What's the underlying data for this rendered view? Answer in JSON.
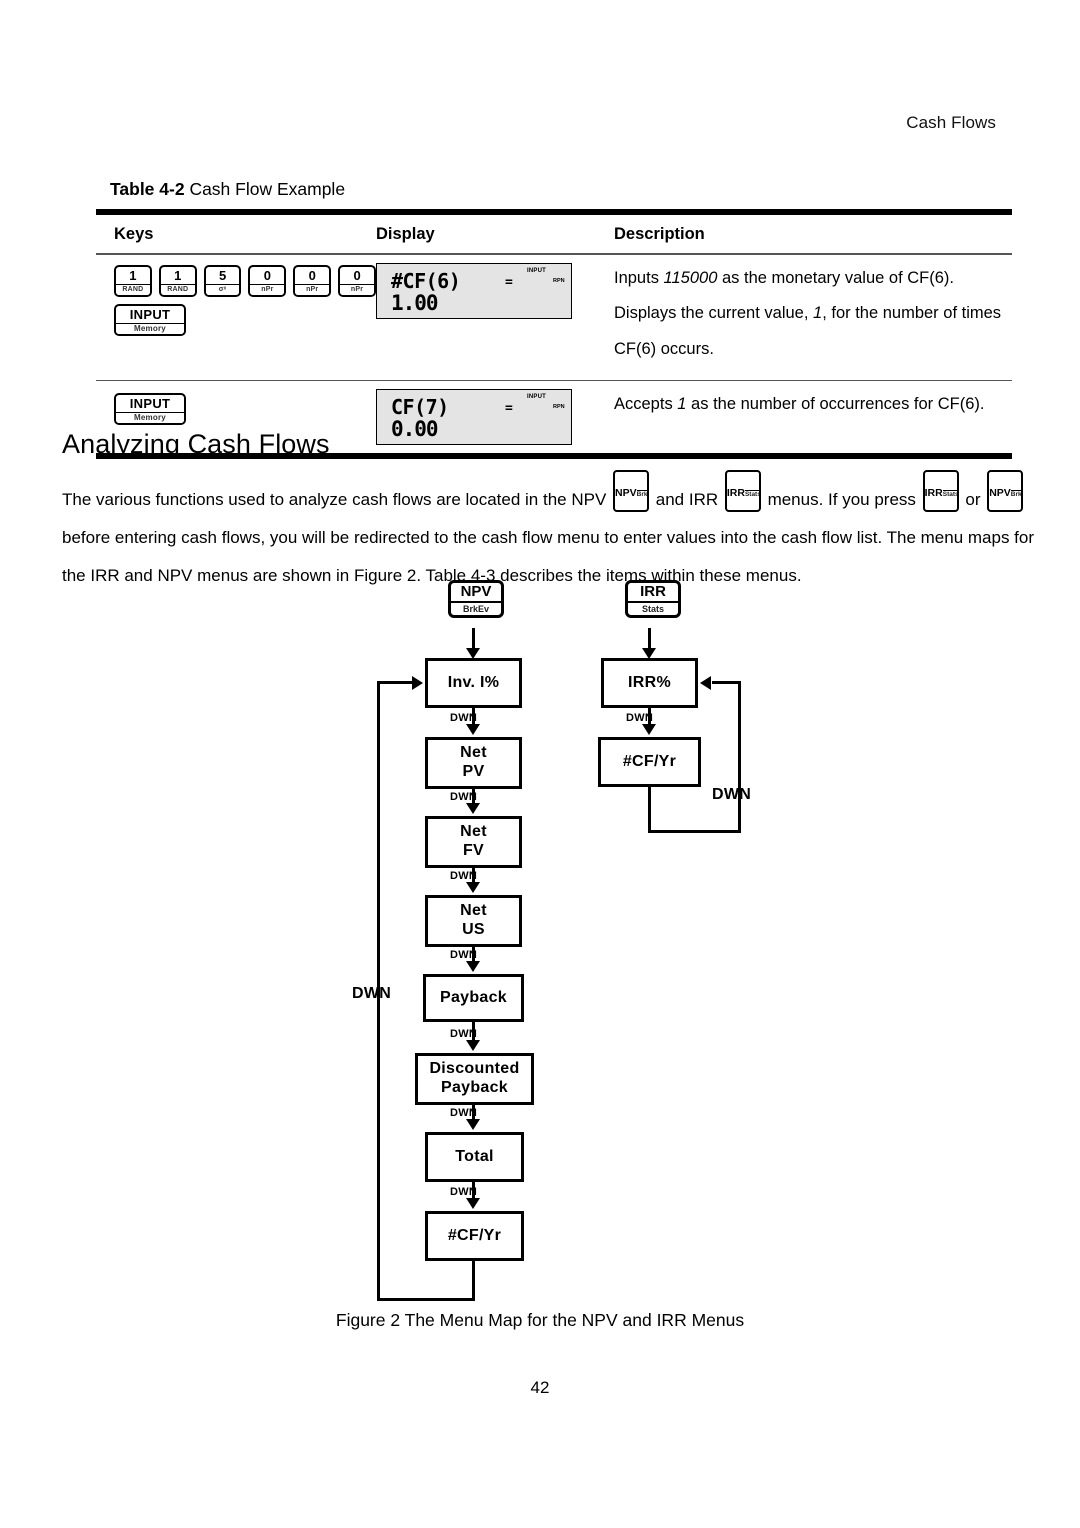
{
  "page": {
    "running_head": "Cash Flows",
    "page_number": "42"
  },
  "table": {
    "caption_label": "Table 4-2",
    "caption_text": " Cash Flow Example",
    "headers": {
      "keys": "Keys",
      "display": "Display",
      "description": "Description"
    },
    "rows": [
      {
        "keys": [
          {
            "main": "1",
            "sub": "RAND"
          },
          {
            "main": "1",
            "sub": "RAND"
          },
          {
            "main": "5",
            "sub": "σˣ"
          },
          {
            "main": "0",
            "sub": "nPr"
          },
          {
            "main": "0",
            "sub": "nPr"
          },
          {
            "main": "0",
            "sub": "nPr"
          }
        ],
        "key_second_row": {
          "main": "INPUT",
          "sub": "Memory"
        },
        "display": {
          "main": "#CF(6)",
          "equals": "=",
          "input_indicator": "INPUT",
          "rpn_indicator": "RPN",
          "value": "1.00"
        },
        "description_lines": [
          {
            "pre": "Inputs ",
            "em": "115000",
            "post": " as the monetary value of CF(6)."
          },
          {
            "pre": "Displays the current value, ",
            "em": "1",
            "post": ", for the number of times"
          },
          {
            "pre": "CF(6) occurs.",
            "em": "",
            "post": ""
          }
        ]
      },
      {
        "keys": [],
        "key_second_row": {
          "main": "INPUT",
          "sub": "Memory"
        },
        "display": {
          "main": "CF(7)",
          "equals": "=",
          "input_indicator": "INPUT",
          "rpn_indicator": "RPN",
          "value": "0.00"
        },
        "description_lines": [
          {
            "pre": "Accepts ",
            "em": "1",
            "post": " as the number of occurrences for CF(6)."
          }
        ]
      }
    ]
  },
  "section": {
    "heading": "Analyzing Cash Flows",
    "paragraph": {
      "seg1": "The various functions used to analyze cash flows are located in the NPV ",
      "key1": {
        "main": "NPV",
        "sub": "BrkEv"
      },
      "seg2": " and IRR ",
      "key2": {
        "main": "IRR",
        "sub": "Stats"
      },
      "seg3": " menus. If you press ",
      "key3": {
        "main": "IRR",
        "sub": "Stats"
      },
      "seg4": " or ",
      "key4": {
        "main": "NPV",
        "sub": "BrkEv"
      },
      "seg5": " before entering cash flows, you will be redirected to the cash flow menu to enter values into the cash flow list. The menu maps for the IRR and NPV menus are shown in Figure 2. Table 4-3 describes the items within these menus."
    }
  },
  "figure": {
    "caption": "Figure 2 The Menu Map for the NPV and IRR Menus",
    "npv_key": {
      "main": "NPV",
      "sub": "BrkEv"
    },
    "irr_key": {
      "main": "IRR",
      "sub": "Stats"
    },
    "npv_nodes": [
      "Inv. I%",
      "Net\nPV",
      "Net\nFV",
      "Net\nUS",
      "Payback",
      "Discounted\nPayback",
      "Total",
      "#CF/Yr"
    ],
    "npv_node_labels": {
      "n0": "Inv. I%",
      "n1_l1": "Net",
      "n1_l2": "PV",
      "n2_l1": "Net",
      "n2_l2": "FV",
      "n3_l1": "Net",
      "n3_l2": "US",
      "n4": "Payback",
      "n5_l1": "Discounted",
      "n5_l2": "Payback",
      "n6": "Total",
      "n7": "#CF/Yr"
    },
    "irr_node_labels": {
      "n0": "IRR%",
      "n1": "#CF/Yr"
    },
    "transition_label": "DWN",
    "loop_label_npv": "DWN",
    "loop_label_irr": "DWN"
  }
}
